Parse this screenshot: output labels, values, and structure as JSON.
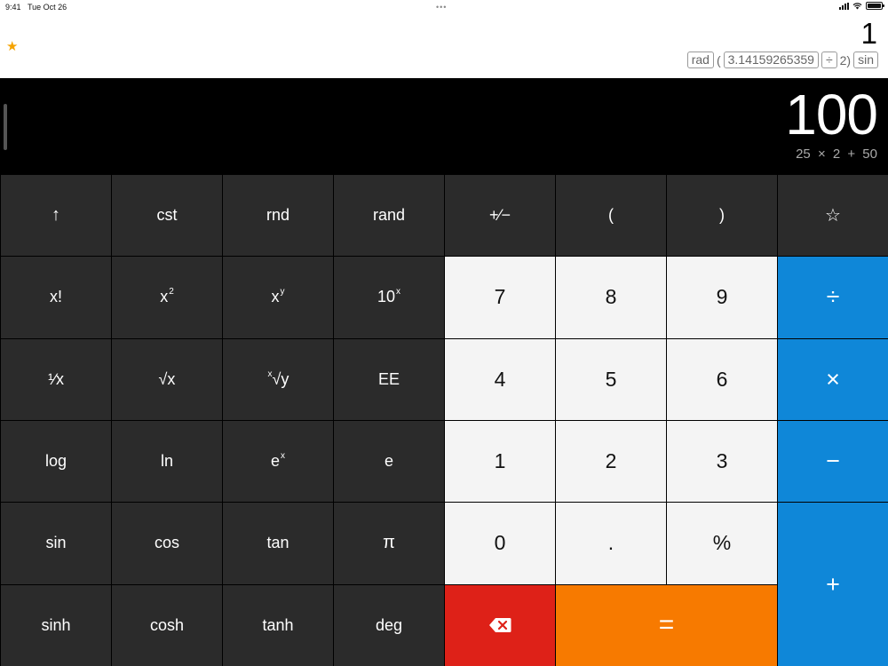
{
  "status": {
    "time": "9:41",
    "date": "Tue Oct 26",
    "dots": "•••"
  },
  "history": {
    "result": "1",
    "tokens": [
      {
        "text": "rad",
        "boxed": true
      },
      {
        "text": "(",
        "boxed": false
      },
      {
        "text": "3.14159265359",
        "boxed": true
      },
      {
        "text": "÷",
        "boxed": true
      },
      {
        "text": "2)",
        "boxed": false
      },
      {
        "text": "sin",
        "boxed": true
      }
    ]
  },
  "display": {
    "value": "100",
    "expression": "25 × 2 + 50"
  },
  "keys": {
    "shift": "↑",
    "cst": "cst",
    "rnd": "rnd",
    "rand": "rand",
    "negate": "+∕−",
    "lparen": "(",
    "rparen": ")",
    "favorite": "☆",
    "factorial": "x!",
    "square_base": "x",
    "square_sup": "2",
    "power_base": "x",
    "power_sup": "y",
    "ten_base": "10",
    "ten_sup": "x",
    "seven": "7",
    "eight": "8",
    "nine": "9",
    "divide": "÷",
    "reciprocal": "¹∕x",
    "sqrt": "√x",
    "root_sup": "x",
    "root_base": "√y",
    "ee": "EE",
    "four": "4",
    "five": "5",
    "six": "6",
    "multiply": "×",
    "log": "log",
    "ln": "ln",
    "exp_base": "e",
    "exp_sup": "x",
    "e": "e",
    "one": "1",
    "two": "2",
    "three": "3",
    "minus": "−",
    "sin": "sin",
    "cos": "cos",
    "tan": "tan",
    "pi": "π",
    "zero": "0",
    "decimal": ".",
    "percent": "%",
    "plus": "+",
    "sinh": "sinh",
    "cosh": "cosh",
    "tanh": "tanh",
    "deg": "deg",
    "backspace": "⌫",
    "equals": "="
  },
  "colors": {
    "operator": "#0f87d8",
    "delete": "#de2118",
    "equals": "#f77a00",
    "star": "#f5a300"
  }
}
